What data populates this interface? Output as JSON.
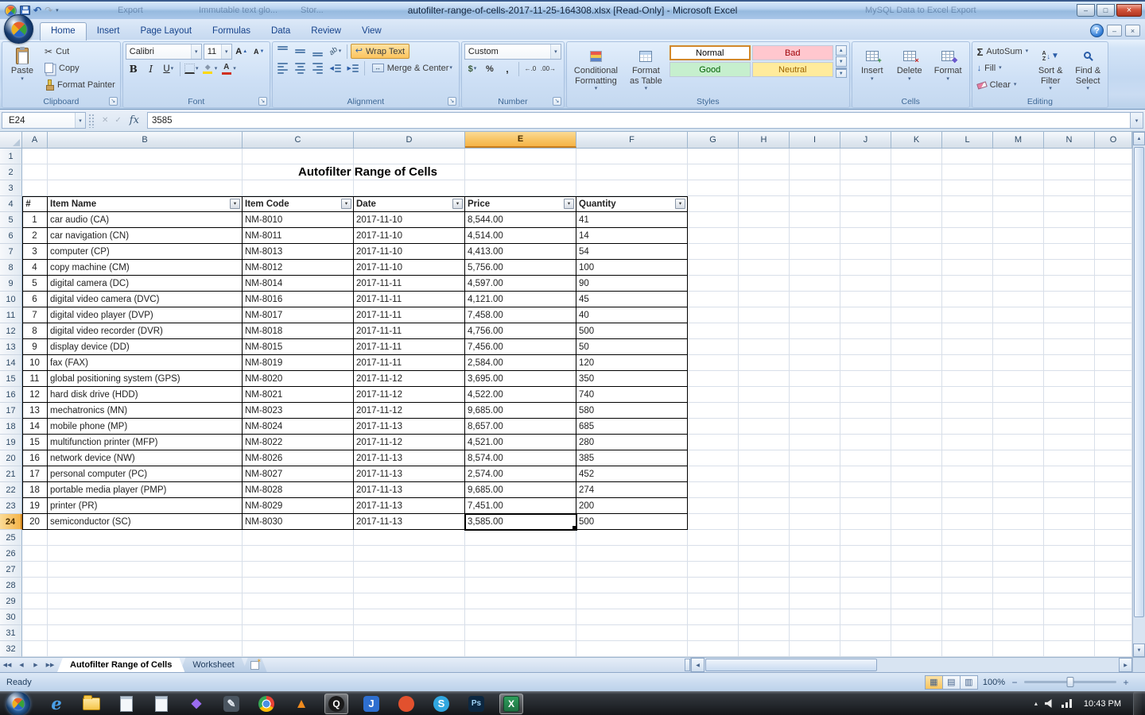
{
  "window": {
    "title": "autofilter-range-of-cells-2017-11-25-164308.xlsx  [Read-Only] - Microsoft Excel",
    "ghost_tabs": [
      "Export",
      "Immutable text glo...",
      "Stor...",
      "MySQL Data to Excel Export"
    ],
    "controls": {
      "minimize": "–",
      "maximize": "□",
      "close": "×"
    }
  },
  "ribbon": {
    "tabs": [
      "Home",
      "Insert",
      "Page Layout",
      "Formulas",
      "Data",
      "Review",
      "View"
    ],
    "help": "?",
    "clipboard": {
      "title": "Clipboard",
      "paste": "Paste",
      "cut": "Cut",
      "copy": "Copy",
      "format_painter": "Format Painter"
    },
    "font": {
      "title": "Font",
      "font_name": "Calibri",
      "font_size": "11"
    },
    "alignment": {
      "title": "Alignment",
      "wrap_text": "Wrap Text",
      "merge_center": "Merge & Center"
    },
    "number": {
      "title": "Number",
      "format": "Custom"
    },
    "styles": {
      "title": "Styles",
      "conditional_line1": "Conditional",
      "conditional_line2": "Formatting",
      "table_line1": "Format",
      "table_line2": "as Table",
      "cell_styles": [
        {
          "label": "Normal",
          "bg": "#ffffff",
          "fg": "#000000",
          "selected": true
        },
        {
          "label": "Bad",
          "bg": "#ffc7ce",
          "fg": "#9c0006",
          "selected": false
        },
        {
          "label": "Good",
          "bg": "#c6efce",
          "fg": "#006100",
          "selected": false
        },
        {
          "label": "Neutral",
          "bg": "#ffeb9c",
          "fg": "#9c6500",
          "selected": false
        }
      ]
    },
    "cells": {
      "title": "Cells",
      "insert": "Insert",
      "delete": "Delete",
      "format": "Format"
    },
    "editing": {
      "title": "Editing",
      "autosum": "AutoSum",
      "fill": "Fill",
      "clear": "Clear",
      "sort_line1": "Sort &",
      "sort_line2": "Filter",
      "find_line1": "Find &",
      "find_line2": "Select"
    }
  },
  "formula_bar": {
    "name_box": "E24",
    "fx": "fx",
    "value": "3585"
  },
  "spreadsheet": {
    "columns": [
      "A",
      "B",
      "C",
      "D",
      "E",
      "F",
      "G",
      "H",
      "I",
      "J",
      "K",
      "L",
      "M",
      "N",
      "O"
    ],
    "row_count": 32,
    "selection": {
      "cell": "E24",
      "column": "E",
      "row": 24
    },
    "title_row": {
      "row": 2,
      "text": "Autofilter Range of Cells"
    },
    "table": {
      "header_row": 4,
      "headers": [
        "#",
        "Item Name",
        "Item Code",
        "Date",
        "Price",
        "Quantity"
      ],
      "filter_columns": [
        "B",
        "C",
        "D",
        "E",
        "F"
      ],
      "rows": [
        [
          "1",
          "car audio (CA)",
          "NM-8010",
          "2017-11-10",
          "8,544.00",
          "41"
        ],
        [
          "2",
          "car navigation (CN)",
          "NM-8011",
          "2017-11-10",
          "4,514.00",
          "14"
        ],
        [
          "3",
          "computer (CP)",
          "NM-8013",
          "2017-11-10",
          "4,413.00",
          "54"
        ],
        [
          "4",
          "copy machine (CM)",
          "NM-8012",
          "2017-11-10",
          "5,756.00",
          "100"
        ],
        [
          "5",
          "digital camera (DC)",
          "NM-8014",
          "2017-11-11",
          "4,597.00",
          "90"
        ],
        [
          "6",
          "digital video camera (DVC)",
          "NM-8016",
          "2017-11-11",
          "4,121.00",
          "45"
        ],
        [
          "7",
          "digital video player (DVP)",
          "NM-8017",
          "2017-11-11",
          "7,458.00",
          "40"
        ],
        [
          "8",
          "digital video recorder (DVR)",
          "NM-8018",
          "2017-11-11",
          "4,756.00",
          "500"
        ],
        [
          "9",
          "display device (DD)",
          "NM-8015",
          "2017-11-11",
          "7,456.00",
          "50"
        ],
        [
          "10",
          "fax (FAX)",
          "NM-8019",
          "2017-11-11",
          "2,584.00",
          "120"
        ],
        [
          "11",
          "global positioning system (GPS)",
          "NM-8020",
          "2017-11-12",
          "3,695.00",
          "350"
        ],
        [
          "12",
          "hard disk drive (HDD)",
          "NM-8021",
          "2017-11-12",
          "4,522.00",
          "740"
        ],
        [
          "13",
          "mechatronics (MN)",
          "NM-8023",
          "2017-11-12",
          "9,685.00",
          "580"
        ],
        [
          "14",
          "mobile phone (MP)",
          "NM-8024",
          "2017-11-13",
          "8,657.00",
          "685"
        ],
        [
          "15",
          "multifunction printer (MFP)",
          "NM-8022",
          "2017-11-12",
          "4,521.00",
          "280"
        ],
        [
          "16",
          "network device (NW)",
          "NM-8026",
          "2017-11-13",
          "8,574.00",
          "385"
        ],
        [
          "17",
          "personal computer (PC)",
          "NM-8027",
          "2017-11-13",
          "2,574.00",
          "452"
        ],
        [
          "18",
          "portable media player (PMP)",
          "NM-8028",
          "2017-11-13",
          "9,685.00",
          "274"
        ],
        [
          "19",
          "printer (PR)",
          "NM-8029",
          "2017-11-13",
          "7,451.00",
          "200"
        ],
        [
          "20",
          "semiconductor (SC)",
          "NM-8030",
          "2017-11-13",
          "3,585.00",
          "500"
        ]
      ]
    }
  },
  "sheet_tabs": {
    "tabs": [
      {
        "label": "Autofilter Range of Cells",
        "active": true
      },
      {
        "label": "Worksheet",
        "active": false
      }
    ]
  },
  "status_bar": {
    "status": "Ready",
    "zoom": "100%"
  },
  "taskbar": {
    "time": "10:43 PM",
    "items": [
      {
        "name": "taskbar-internet-explorer",
        "kind": "letter",
        "glyph": "e",
        "fg": "#4aa0e8",
        "shape": "none",
        "italic": true,
        "size": 21
      },
      {
        "name": "taskbar-explorer",
        "kind": "folder"
      },
      {
        "name": "taskbar-app-window",
        "kind": "page"
      },
      {
        "name": "taskbar-notepad",
        "kind": "page"
      },
      {
        "name": "taskbar-app-violet",
        "kind": "letter",
        "glyph": "◆",
        "fg": "#9a6cf0",
        "shape": "none",
        "size": 16
      },
      {
        "name": "taskbar-app-editor",
        "kind": "letter",
        "glyph": "✎",
        "fg": "#e8eef5",
        "bg": "#4a5560",
        "shape": "square",
        "size": 13
      },
      {
        "name": "taskbar-chrome",
        "kind": "chrome"
      },
      {
        "name": "taskbar-vlc",
        "kind": "letter",
        "glyph": "▲",
        "fg": "#f08b1e",
        "shape": "none",
        "size": 17
      },
      {
        "name": "taskbar-qq",
        "kind": "letter",
        "glyph": "Q",
        "fg": "#ffffff",
        "bg": "#1a1a1a",
        "shape": "circle",
        "size": 12,
        "active": true
      },
      {
        "name": "taskbar-app-j",
        "kind": "letter",
        "glyph": "J",
        "fg": "#ffffff",
        "bg": "#2e6fd0",
        "shape": "square",
        "size": 13
      },
      {
        "name": "taskbar-app-red",
        "kind": "letter",
        "glyph": "",
        "fg": "#ffffff",
        "bg": "#e2512e",
        "shape": "circle",
        "size": 11
      },
      {
        "name": "taskbar-skype",
        "kind": "letter",
        "glyph": "S",
        "fg": "#ffffff",
        "bg": "#31a7e0",
        "shape": "circle",
        "size": 13
      },
      {
        "name": "taskbar-photoshop",
        "kind": "letter",
        "glyph": "Ps",
        "fg": "#9fd2f5",
        "bg": "#0c2740",
        "shape": "square",
        "size": 10
      },
      {
        "name": "taskbar-excel",
        "kind": "excel",
        "glyph": "X",
        "active": true
      }
    ]
  }
}
